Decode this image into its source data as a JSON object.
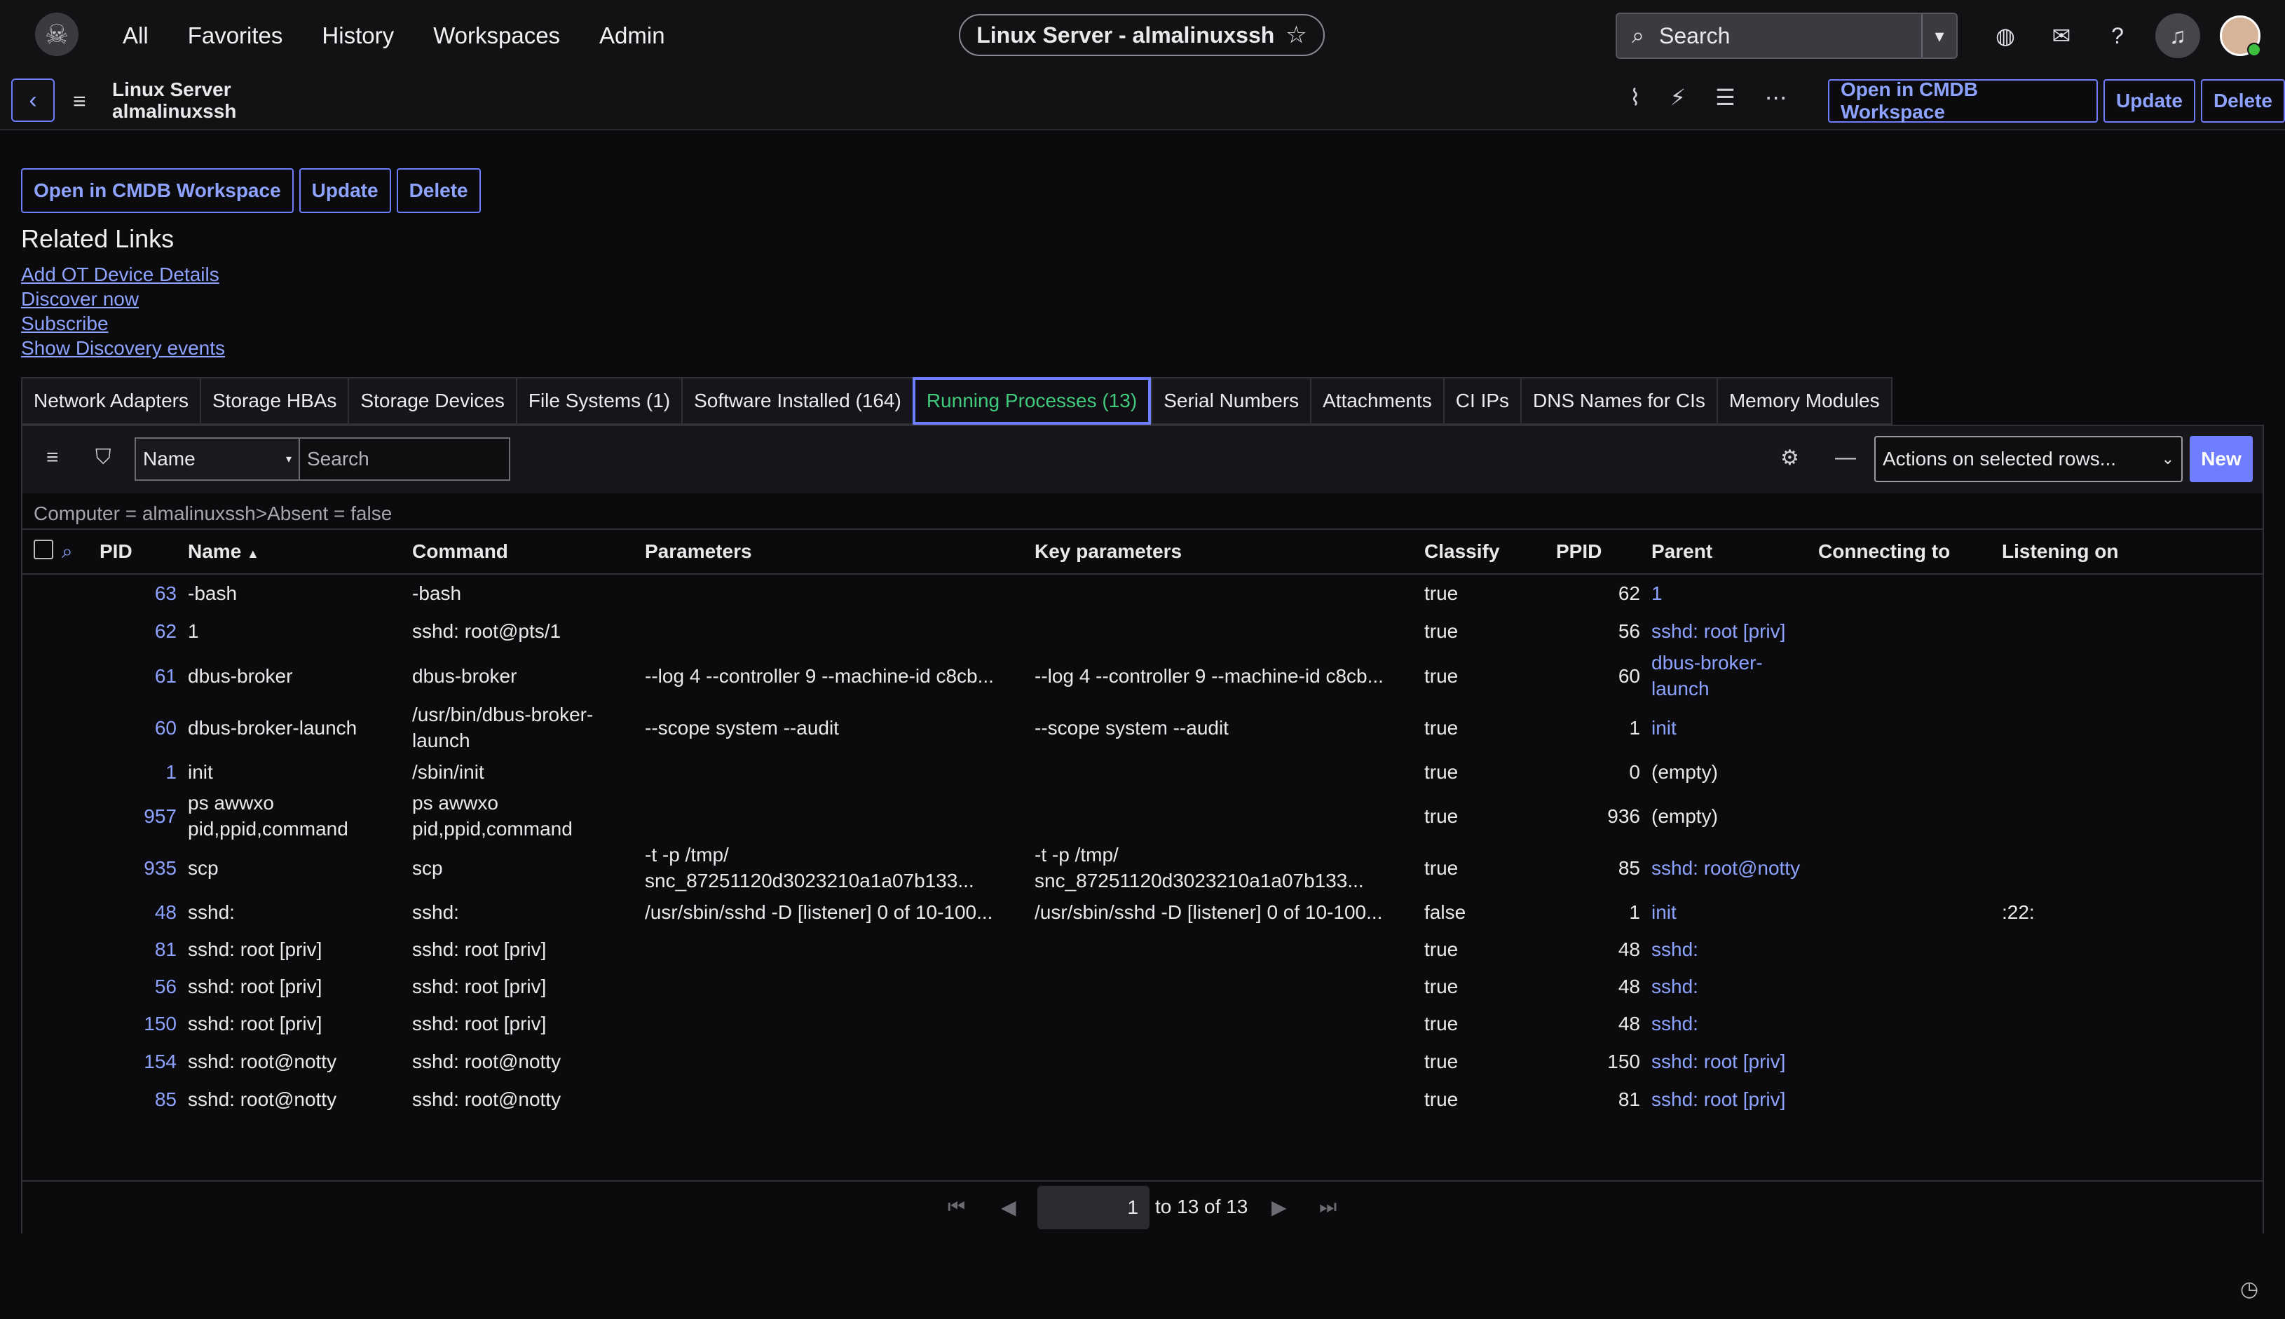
{
  "nav": {
    "items": [
      "All",
      "Favorites",
      "History",
      "Workspaces",
      "Admin"
    ],
    "record_pill": "Linux Server - almalinuxssh",
    "search_placeholder": "Search"
  },
  "header": {
    "line1": "Linux Server",
    "line2": "almalinuxssh",
    "buttons": [
      "Open in CMDB Workspace",
      "Update",
      "Delete"
    ]
  },
  "form_buttons": [
    "Open in CMDB Workspace",
    "Update",
    "Delete"
  ],
  "related_links": {
    "title": "Related Links",
    "links": [
      "Add OT Device Details",
      "Discover now",
      "Subscribe",
      "Show Discovery events"
    ]
  },
  "tabs": [
    "Network Adapters",
    "Storage HBAs",
    "Storage Devices",
    "File Systems (1)",
    "Software Installed (164)",
    "Running Processes (13)",
    "Serial Numbers",
    "Attachments",
    "CI IPs",
    "DNS Names for CIs",
    "Memory Modules"
  ],
  "active_tab": "Running Processes (13)",
  "list": {
    "field_select": "Name",
    "search_placeholder": "Search",
    "actions_select": "Actions on selected rows...",
    "new_label": "New",
    "breadcrumb_a": "Computer = almalinuxssh",
    "breadcrumb_sep": ">",
    "breadcrumb_b": "Absent = false",
    "columns": [
      "PID",
      "Name",
      "Command",
      "Parameters",
      "Key parameters",
      "Classify",
      "PPID",
      "Parent",
      "Connecting to",
      "Listening on"
    ],
    "sort_indicator": "▲",
    "rows": [
      {
        "pid": "63",
        "name": "-bash",
        "command": "-bash",
        "params": "",
        "key": "",
        "classify": "true",
        "ppid": "62",
        "parent": "1",
        "conn": "",
        "listen": ""
      },
      {
        "pid": "62",
        "name": "1",
        "command": "sshd: root@pts/1",
        "params": "",
        "key": "",
        "classify": "true",
        "ppid": "56",
        "parent": "sshd: root [priv]",
        "conn": "",
        "listen": ""
      },
      {
        "pid": "61",
        "name": "dbus-broker",
        "command": "dbus-broker",
        "params": "--log 4 --controller 9 --machine-id c8cb...",
        "key": "--log 4 --controller 9 --machine-id c8cb...",
        "classify": "true",
        "ppid": "60",
        "parent": "dbus-broker-launch",
        "conn": "",
        "listen": ""
      },
      {
        "pid": "60",
        "name": "dbus-broker-launch",
        "command": "/usr/bin/dbus-broker-launch",
        "params": "--scope system --audit",
        "key": "--scope system --audit",
        "classify": "true",
        "ppid": "1",
        "parent": "init",
        "conn": "",
        "listen": ""
      },
      {
        "pid": "1",
        "name": "init",
        "command": "/sbin/init",
        "params": "",
        "key": "",
        "classify": "true",
        "ppid": "0",
        "parent": "(empty)",
        "conn": "",
        "listen": ""
      },
      {
        "pid": "957",
        "name": "ps awwxo pid,ppid,command",
        "command": "ps awwxo pid,ppid,command",
        "params": "",
        "key": "",
        "classify": "true",
        "ppid": "936",
        "parent": "(empty)",
        "conn": "",
        "listen": ""
      },
      {
        "pid": "935",
        "name": "scp",
        "command": "scp",
        "params": "-t -p /tmp/ snc_87251120d3023210a1a07b133...",
        "key": "-t -p /tmp/ snc_87251120d3023210a1a07b133...",
        "classify": "true",
        "ppid": "85",
        "parent": "sshd: root@notty",
        "conn": "",
        "listen": ""
      },
      {
        "pid": "48",
        "name": "sshd:",
        "command": "sshd:",
        "params": "/usr/sbin/sshd -D [listener] 0 of 10-100...",
        "key": "/usr/sbin/sshd -D [listener] 0 of 10-100...",
        "classify": "false",
        "ppid": "1",
        "parent": "init",
        "conn": "",
        "listen": ":22:"
      },
      {
        "pid": "81",
        "name": "sshd: root [priv]",
        "command": "sshd: root [priv]",
        "params": "",
        "key": "",
        "classify": "true",
        "ppid": "48",
        "parent": "sshd:",
        "conn": "",
        "listen": ""
      },
      {
        "pid": "56",
        "name": "sshd: root [priv]",
        "command": "sshd: root [priv]",
        "params": "",
        "key": "",
        "classify": "true",
        "ppid": "48",
        "parent": "sshd:",
        "conn": "",
        "listen": ""
      },
      {
        "pid": "150",
        "name": "sshd: root [priv]",
        "command": "sshd: root [priv]",
        "params": "",
        "key": "",
        "classify": "true",
        "ppid": "48",
        "parent": "sshd:",
        "conn": "",
        "listen": ""
      },
      {
        "pid": "154",
        "name": "sshd: root@notty",
        "command": "sshd: root@notty",
        "params": "",
        "key": "",
        "classify": "true",
        "ppid": "150",
        "parent": "sshd: root [priv]",
        "conn": "",
        "listen": ""
      },
      {
        "pid": "85",
        "name": "sshd: root@notty",
        "command": "sshd: root@notty",
        "params": "",
        "key": "",
        "classify": "true",
        "ppid": "81",
        "parent": "sshd: root [priv]",
        "conn": "",
        "listen": ""
      }
    ]
  },
  "pager": {
    "page_input": "1",
    "range_text": "to 13 of 13"
  },
  "colors": {
    "accent": "#6f7eff",
    "link": "#8ea2ff",
    "active_tab_text": "#41c97e",
    "background": "#0b0b0d"
  },
  "icons": [
    "skull-logo-icon",
    "star-icon",
    "search-icon",
    "chevron-down-icon",
    "globe-icon",
    "chat-icon",
    "help-icon",
    "bell-icon",
    "back-icon",
    "hamburger-icon",
    "paperclip-icon",
    "activity-icon",
    "sliders-icon",
    "more-icon",
    "filter-icon",
    "gear-icon",
    "minus-icon",
    "first-page-icon",
    "prev-page-icon",
    "next-page-icon",
    "last-page-icon",
    "clock-icon"
  ]
}
